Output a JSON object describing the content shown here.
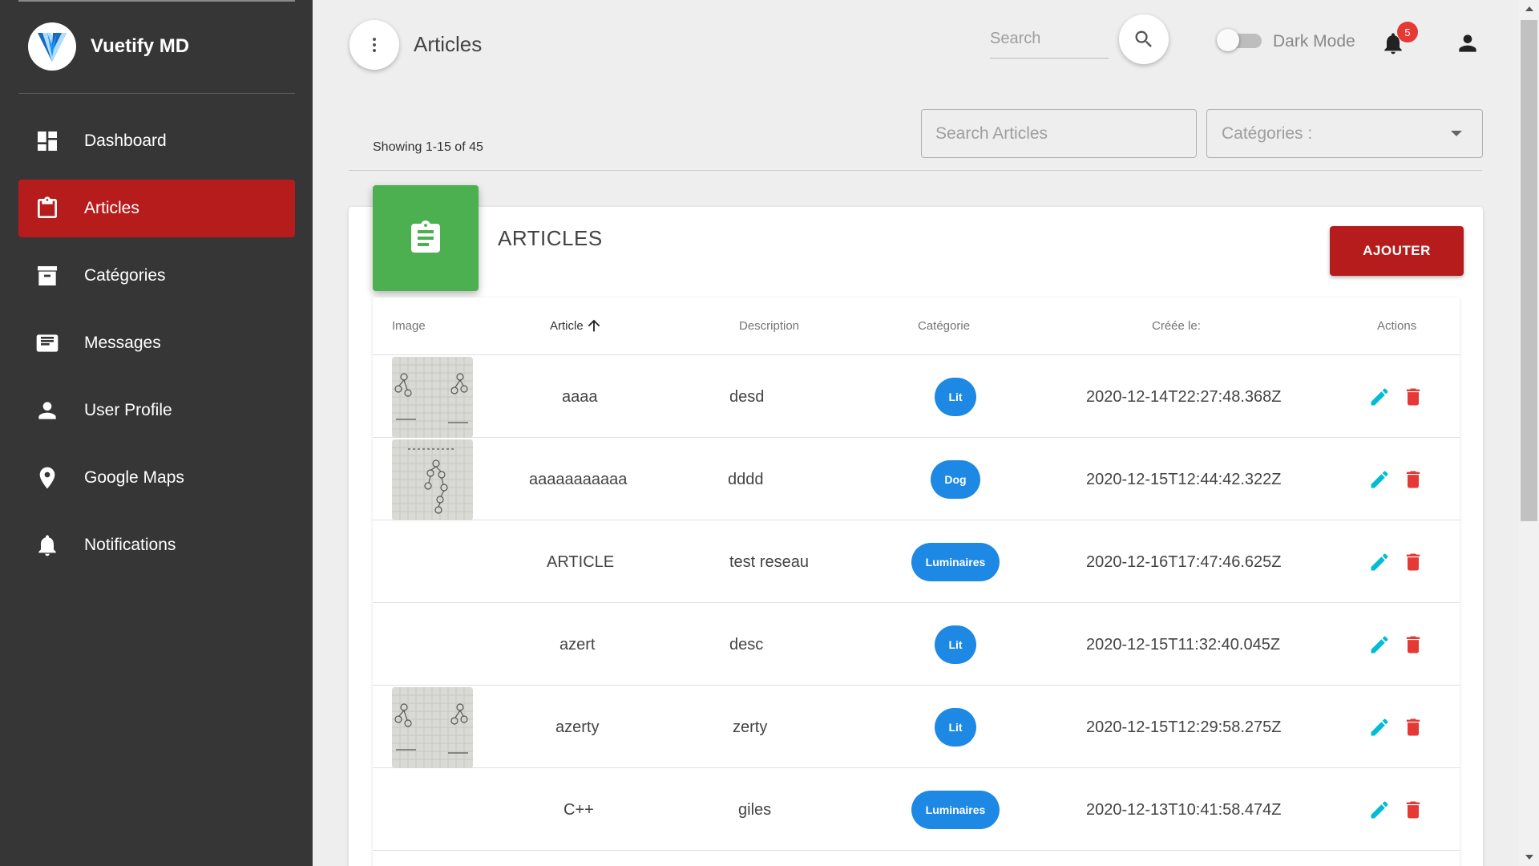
{
  "sidebar": {
    "brand": "Vuetify MD",
    "items": [
      {
        "label": "Dashboard",
        "icon": "dashboard-icon"
      },
      {
        "label": "Articles",
        "icon": "clipboard-icon",
        "active": true
      },
      {
        "label": "Catégories",
        "icon": "archive-icon"
      },
      {
        "label": "Messages",
        "icon": "message-icon"
      },
      {
        "label": "User Profile",
        "icon": "person-icon"
      },
      {
        "label": "Google Maps",
        "icon": "map-marker-icon"
      },
      {
        "label": "Notifications",
        "icon": "bell-icon"
      }
    ]
  },
  "topbar": {
    "title": "Articles",
    "search_placeholder": "Search",
    "dark_mode_label": "Dark Mode",
    "notification_count": "5"
  },
  "filters": {
    "showing": "Showing 1-15 of 45",
    "search_placeholder": "Search Articles",
    "category_label": "Catégories :"
  },
  "card": {
    "title": "ARTICLES",
    "add_label": "AJOUTER"
  },
  "table": {
    "headers": [
      "Image",
      "Article",
      "Description",
      "Catégorie",
      "Créée le:",
      "Actions"
    ],
    "rows": [
      {
        "article": "aaaa",
        "description": "desd",
        "category": "Lit",
        "created": "2020-12-14T22:27:48.368Z",
        "image": true
      },
      {
        "article": "aaaaaaaaaaa",
        "description": "dddd",
        "category": "Dog",
        "created": "2020-12-15T12:44:42.322Z",
        "image": true
      },
      {
        "article": "ARTICLE",
        "description": "test reseau",
        "category": "Luminaires",
        "created": "2020-12-16T17:47:46.625Z",
        "image": false
      },
      {
        "article": "azert",
        "description": "desc",
        "category": "Lit",
        "created": "2020-12-15T11:32:40.045Z",
        "image": false
      },
      {
        "article": "azerty",
        "description": "zerty",
        "category": "Lit",
        "created": "2020-12-15T12:29:58.275Z",
        "image": true
      },
      {
        "article": "C++",
        "description": "giles",
        "category": "Luminaires",
        "created": "2020-12-13T10:41:58.474Z",
        "image": false
      }
    ]
  },
  "colors": {
    "sidebar_bg": "#363636",
    "accent": "#b71c1c",
    "header_icon": "#4caf50",
    "chip": "#1e88e5",
    "edit": "#00bcd4",
    "delete": "#e53935"
  }
}
